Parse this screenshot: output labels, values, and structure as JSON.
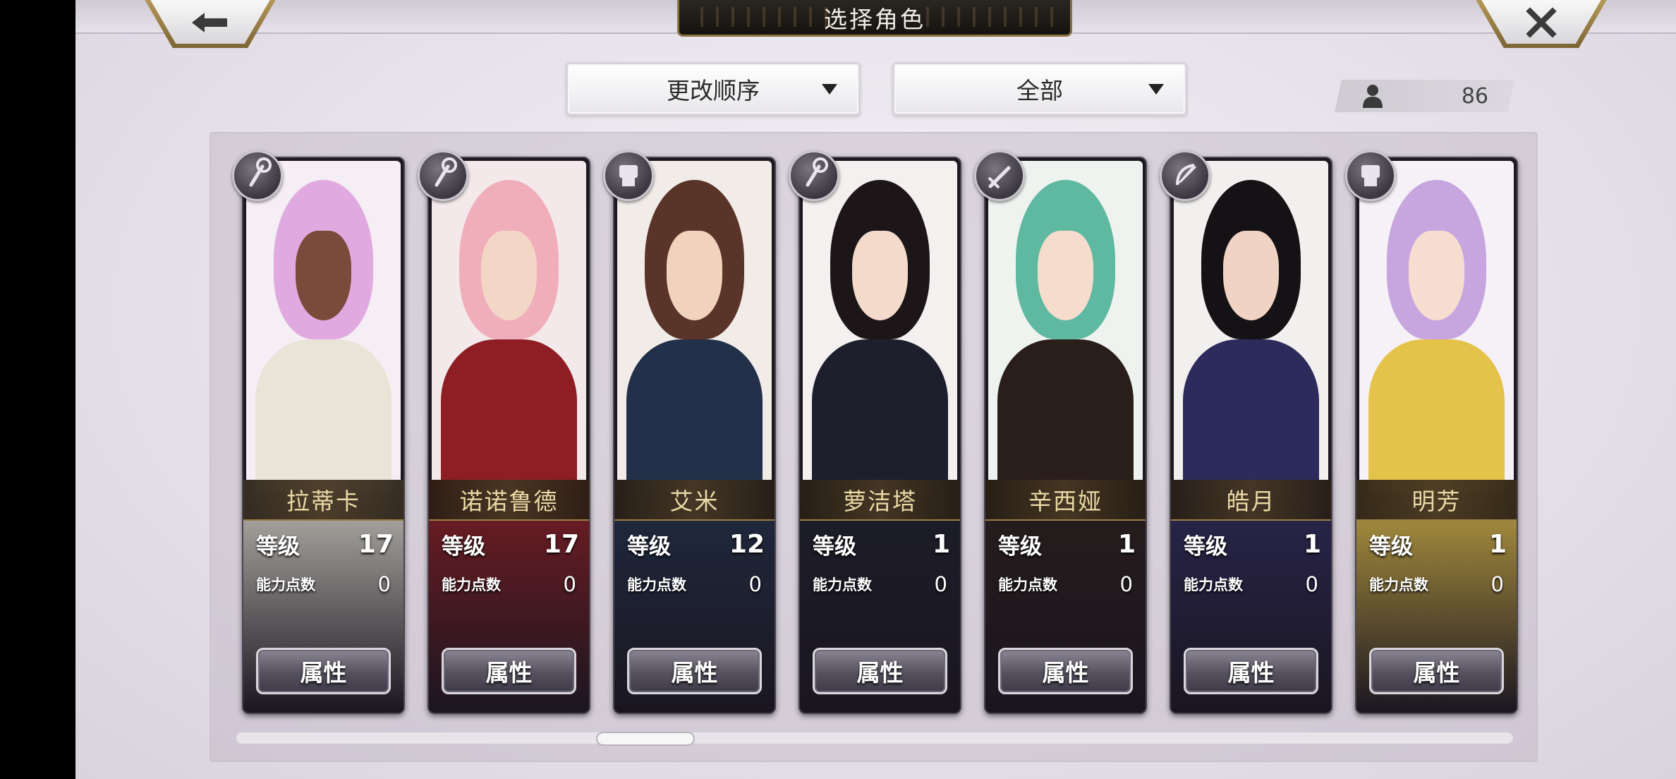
{
  "header": {
    "title": "选择角色"
  },
  "controls": {
    "sort_label": "更改顺序",
    "filter_label": "全部",
    "character_count": "86"
  },
  "labels": {
    "level": "等级",
    "ability_points": "能力点数",
    "attributes_button": "属性"
  },
  "characters": [
    {
      "name": "拉蒂卡",
      "level": "17",
      "ability_points": "0",
      "class_icon": "staff-icon"
    },
    {
      "name": "诺诺鲁德",
      "level": "17",
      "ability_points": "0",
      "class_icon": "staff-icon"
    },
    {
      "name": "艾米",
      "level": "12",
      "ability_points": "0",
      "class_icon": "gauntlet-icon"
    },
    {
      "name": "萝洁塔",
      "level": "1",
      "ability_points": "0",
      "class_icon": "staff-icon"
    },
    {
      "name": "辛西娅",
      "level": "1",
      "ability_points": "0",
      "class_icon": "sword-icon"
    },
    {
      "name": "皓月",
      "level": "1",
      "ability_points": "0",
      "class_icon": "bow-icon"
    },
    {
      "name": "明芳",
      "level": "1",
      "ability_points": "0",
      "class_icon": "gauntlet-icon"
    }
  ],
  "scroll": {
    "position_fraction": 0.29
  }
}
